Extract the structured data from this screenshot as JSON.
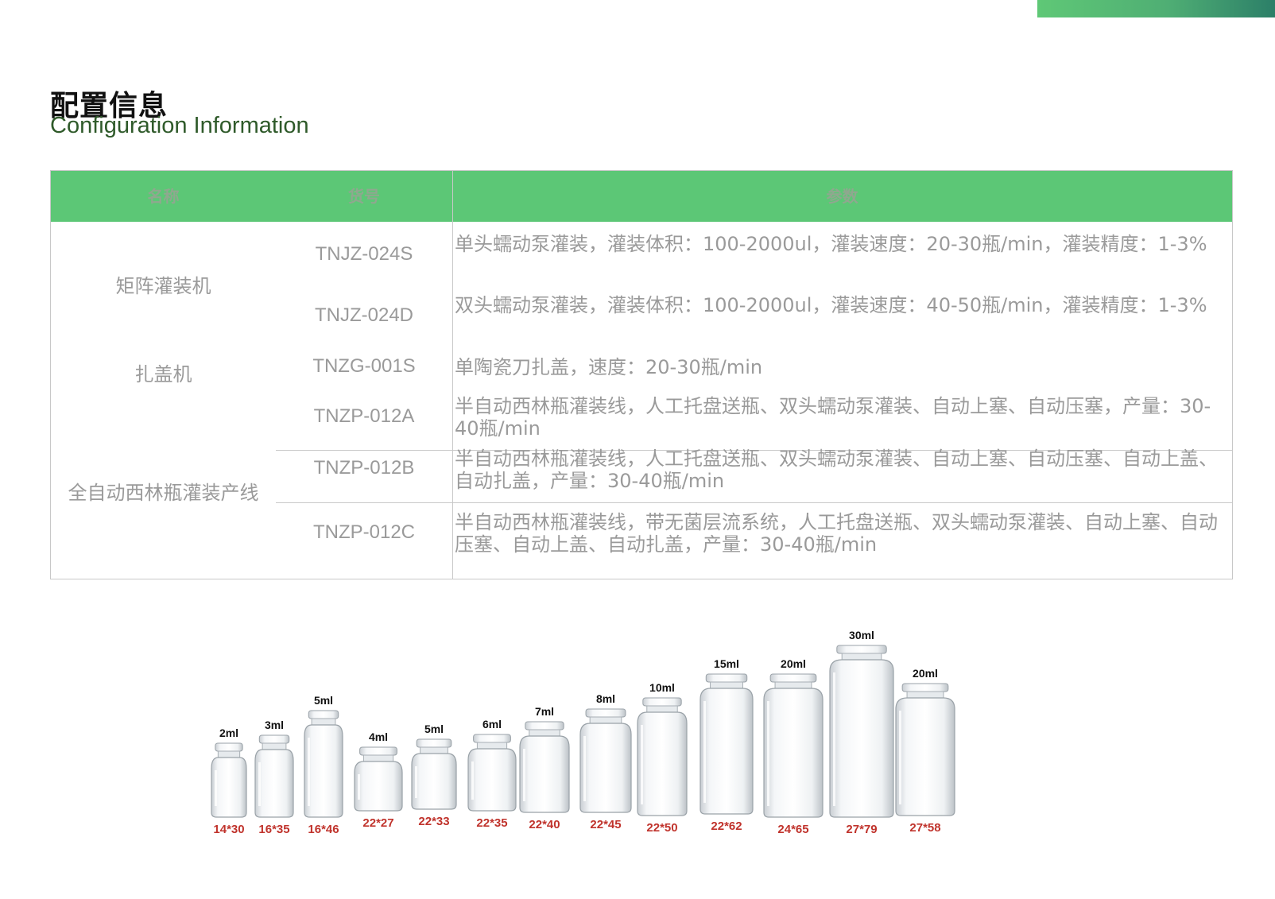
{
  "header": {
    "title_cn": "配置信息",
    "title_en": "Configuration Information"
  },
  "colors": {
    "accent_green": "#5cc776",
    "table_text": "#9a9a9a",
    "size_label_red": "#c0332c"
  },
  "table": {
    "columns": [
      "名称",
      "货号",
      "参数"
    ],
    "rows": [
      {
        "name": "矩阵灌装机",
        "code": "TNJZ-024S",
        "params": "单头蠕动泵灌装，灌装体积：100-2000ul，灌装速度：20-30瓶/min，灌装精度：1-3%"
      },
      {
        "name": "",
        "code": "TNJZ-024D",
        "params": "双头蠕动泵灌装，灌装体积：100-2000ul，灌装速度：40-50瓶/min，灌装精度：1-3%"
      },
      {
        "name": "扎盖机",
        "code": "TNZG-001S",
        "params": "单陶瓷刀扎盖，速度：20-30瓶/min"
      },
      {
        "name": "",
        "code": "TNZP-012A",
        "params": "半自动西林瓶灌装线，人工托盘送瓶、双头蠕动泵灌装、自动上塞、自动压塞，产量：30-40瓶/min"
      },
      {
        "name": "全自动西林瓶灌装产线",
        "code": "TNZP-012B",
        "params": "半自动西林瓶灌装线，人工托盘送瓶、双头蠕动泵灌装、自动上塞、自动压塞、自动上盖、自动扎盖，产量：30-40瓶/min"
      },
      {
        "name": "",
        "code": "TNZP-012C",
        "params": "半自动西林瓶灌装线，带无菌层流系统，人工托盘送瓶、双头蠕动泵灌装、自动上塞、自动压塞、自动上盖、自动扎盖，产量：30-40瓶/min"
      }
    ]
  },
  "bottles": [
    {
      "volume": "2ml",
      "size": "14*30"
    },
    {
      "volume": "3ml",
      "size": "16*35"
    },
    {
      "volume": "5ml",
      "size": "16*46"
    },
    {
      "volume": "4ml",
      "size": "22*27"
    },
    {
      "volume": "5ml",
      "size": "22*33"
    },
    {
      "volume": "6ml",
      "size": "22*35"
    },
    {
      "volume": "7ml",
      "size": "22*40"
    },
    {
      "volume": "8ml",
      "size": "22*45"
    },
    {
      "volume": "10ml",
      "size": "22*50"
    },
    {
      "volume": "15ml",
      "size": "22*62"
    },
    {
      "volume": "20ml",
      "size": "24*65"
    },
    {
      "volume": "30ml",
      "size": "27*79"
    },
    {
      "volume": "20ml",
      "size": "27*58"
    }
  ]
}
